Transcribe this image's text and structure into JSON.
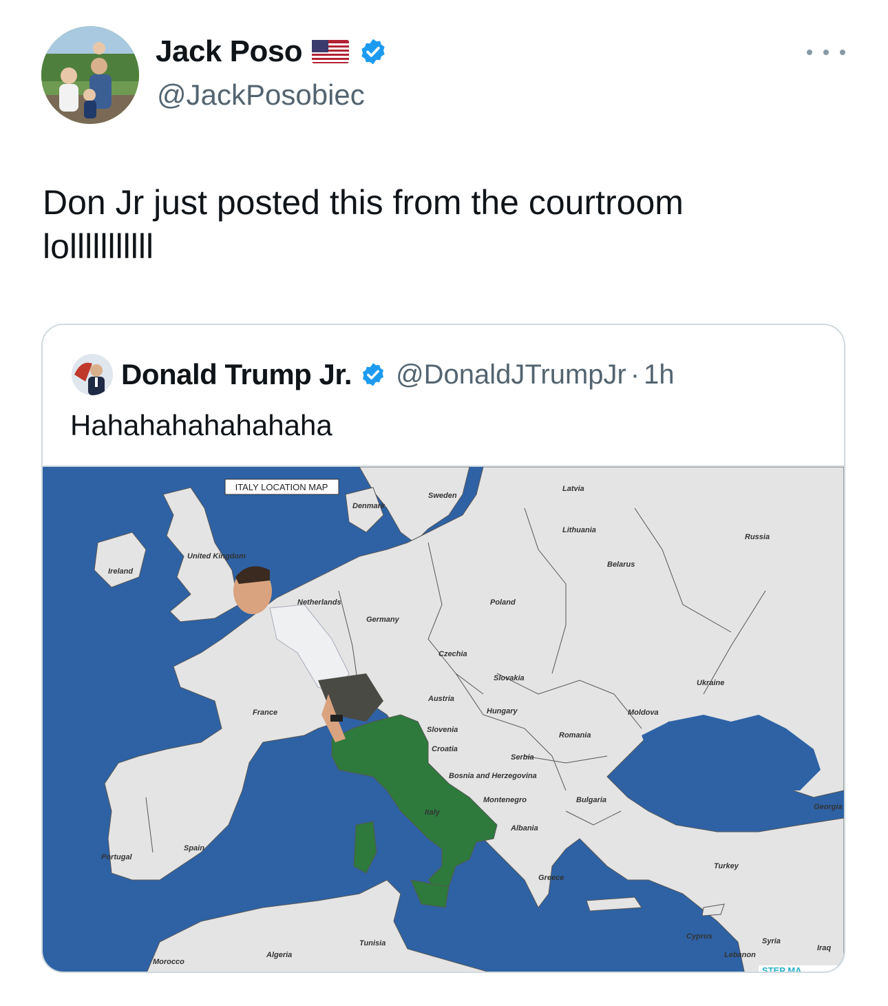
{
  "tweet": {
    "author_name": "Jack Poso",
    "author_handle": "@JackPosobiec",
    "text": "Don Jr just posted this from the courtroom\nlolllllllllll",
    "icons": [
      "us-flag-icon",
      "verified-badge-icon",
      "more-icon"
    ]
  },
  "quote": {
    "author_name": "Donald Trump Jr.",
    "author_handle": "@DonaldJTrumpJr",
    "separator": "·",
    "time": "1h",
    "text": "Hahahahahahahaha",
    "map": {
      "title": "ITALY LOCATION MAP",
      "watermark": "STEP MA",
      "labels": {
        "ireland": "Ireland",
        "uk": "United Kingdom",
        "denmark": "Denmark",
        "sweden": "Sweden",
        "latvia": "Latvia",
        "lithuania": "Lithuania",
        "russia": "Russia",
        "belarus": "Belarus",
        "netherlands": "Netherlands",
        "germany": "Germany",
        "poland": "Poland",
        "czechia": "Czechia",
        "slovakia": "Slovakia",
        "austria": "Austria",
        "hungary": "Hungary",
        "ukraine": "Ukraine",
        "moldova": "Moldova",
        "france": "France",
        "slovenia": "Slovenia",
        "croatia": "Croatia",
        "romania": "Romania",
        "serbia": "Serbia",
        "bosnia": "Bosnia and Herzegovina",
        "montenegro": "Montenegro",
        "bulgaria": "Bulgaria",
        "albania": "Albania",
        "italy": "Italy",
        "georgia": "Georgia",
        "spain": "Spain",
        "portugal": "Portugal",
        "greece": "Greece",
        "turkey": "Turkey",
        "cyprus": "Cyprus",
        "syria": "Syria",
        "lebanon": "Lebanon",
        "iraq": "Iraq",
        "morocco": "Morocco",
        "algeria": "Algeria",
        "tunisia": "Tunisia"
      },
      "colors": {
        "sea": "#2e62a5",
        "land": "#e4e4e4",
        "italy": "#2d7a3c",
        "border": "#555555"
      }
    }
  }
}
